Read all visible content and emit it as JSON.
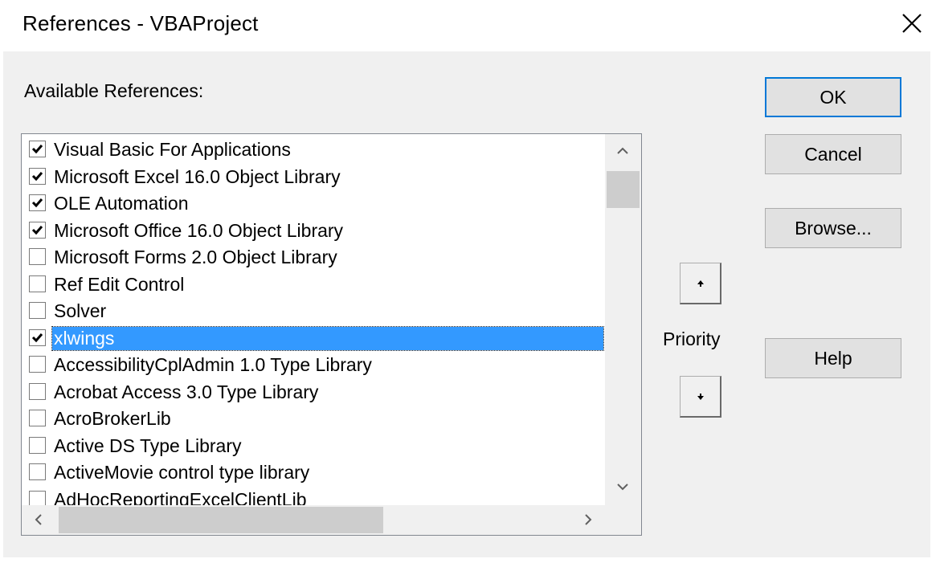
{
  "window": {
    "title": "References - VBAProject",
    "close_icon": "close-icon"
  },
  "available_label": "Available References:",
  "references": [
    {
      "label": "Visual Basic For Applications",
      "checked": true,
      "selected": false
    },
    {
      "label": "Microsoft Excel 16.0 Object Library",
      "checked": true,
      "selected": false
    },
    {
      "label": "OLE Automation",
      "checked": true,
      "selected": false
    },
    {
      "label": "Microsoft Office 16.0 Object Library",
      "checked": true,
      "selected": false
    },
    {
      "label": "Microsoft Forms 2.0 Object Library",
      "checked": false,
      "selected": false
    },
    {
      "label": "Ref Edit Control",
      "checked": false,
      "selected": false
    },
    {
      "label": "Solver",
      "checked": false,
      "selected": false
    },
    {
      "label": "xlwings",
      "checked": true,
      "selected": true
    },
    {
      "label": "AccessibilityCplAdmin 1.0 Type Library",
      "checked": false,
      "selected": false
    },
    {
      "label": "Acrobat Access 3.0 Type Library",
      "checked": false,
      "selected": false
    },
    {
      "label": "AcroBrokerLib",
      "checked": false,
      "selected": false
    },
    {
      "label": "Active DS Type Library",
      "checked": false,
      "selected": false
    },
    {
      "label": "ActiveMovie control type library",
      "checked": false,
      "selected": false
    },
    {
      "label": "AdHocReportingExcelClientLib",
      "checked": false,
      "selected": false
    }
  ],
  "buttons": {
    "ok": "OK",
    "cancel": "Cancel",
    "browse": "Browse...",
    "help": "Help"
  },
  "priority": {
    "label": "Priority",
    "up_icon": "arrow-up-icon",
    "down_icon": "arrow-down-icon"
  },
  "colors": {
    "selection": "#3399ff",
    "default_button_border": "#0078d7",
    "dialog_bg": "#f0f0f0"
  }
}
